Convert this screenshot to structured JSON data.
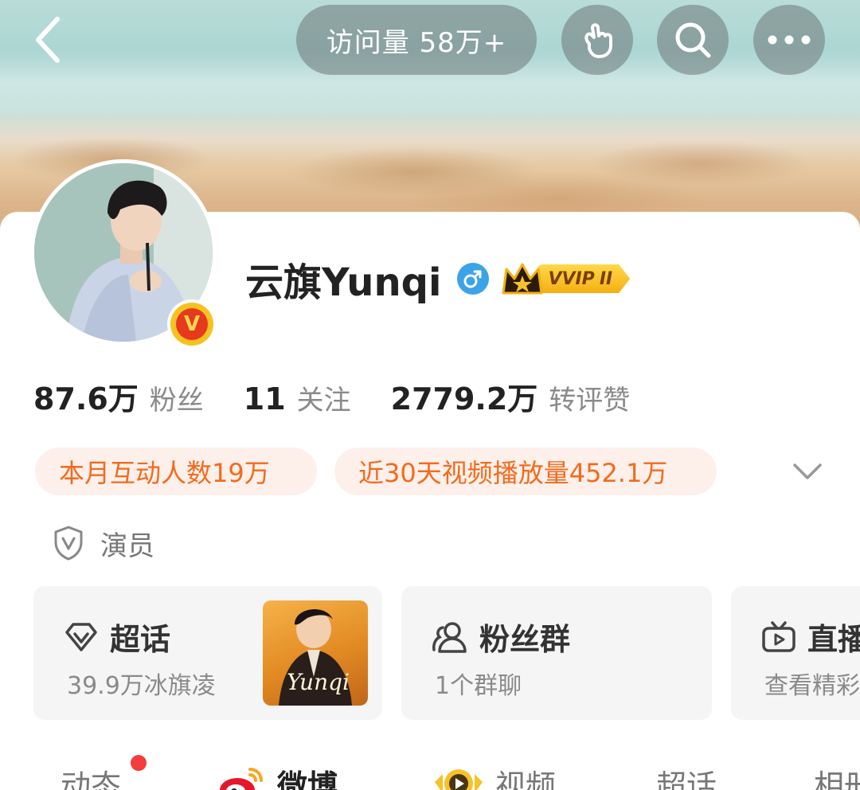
{
  "header": {
    "visit_label": "访问量 58万+",
    "icons": [
      "back-icon",
      "poke-hand-icon",
      "search-icon",
      "more-icon"
    ]
  },
  "profile": {
    "username": "云旗Yunqi",
    "gender_icon": "male-icon",
    "vip_label": "VVIP",
    "vip_level": "II",
    "verified_badge": "V",
    "verified_color": "#e63a1f"
  },
  "stats": [
    {
      "value": "87.6万",
      "label": "粉丝"
    },
    {
      "value": "11",
      "label": "关注"
    },
    {
      "value": "2779.2万",
      "label": "转评赞"
    }
  ],
  "tags": [
    "本月互动人数19万",
    "近30天视频播放量452.1万"
  ],
  "identity": {
    "icon": "shield-v-icon",
    "label": "演员"
  },
  "features": [
    {
      "title": "超话",
      "subtitle": "39.9万冰旗凌",
      "icon": "diamond-icon",
      "thumb_text": "Yunqi"
    },
    {
      "title": "粉丝群",
      "subtitle": "1个群聊",
      "icon": "users-icon"
    },
    {
      "title": "直播",
      "subtitle": "查看精彩",
      "icon": "tv-icon"
    }
  ],
  "tabs": [
    {
      "label": "动态",
      "has_dot": true
    },
    {
      "label": "微博",
      "active": true
    },
    {
      "label": "视频"
    },
    {
      "label": "超话"
    },
    {
      "label": "相册"
    }
  ],
  "colors": {
    "accent_orange": "#f36a1d",
    "tag_bg": "#fdf0ea",
    "gender_blue": "#3da3e8",
    "vip_gold": "#f4b012"
  }
}
